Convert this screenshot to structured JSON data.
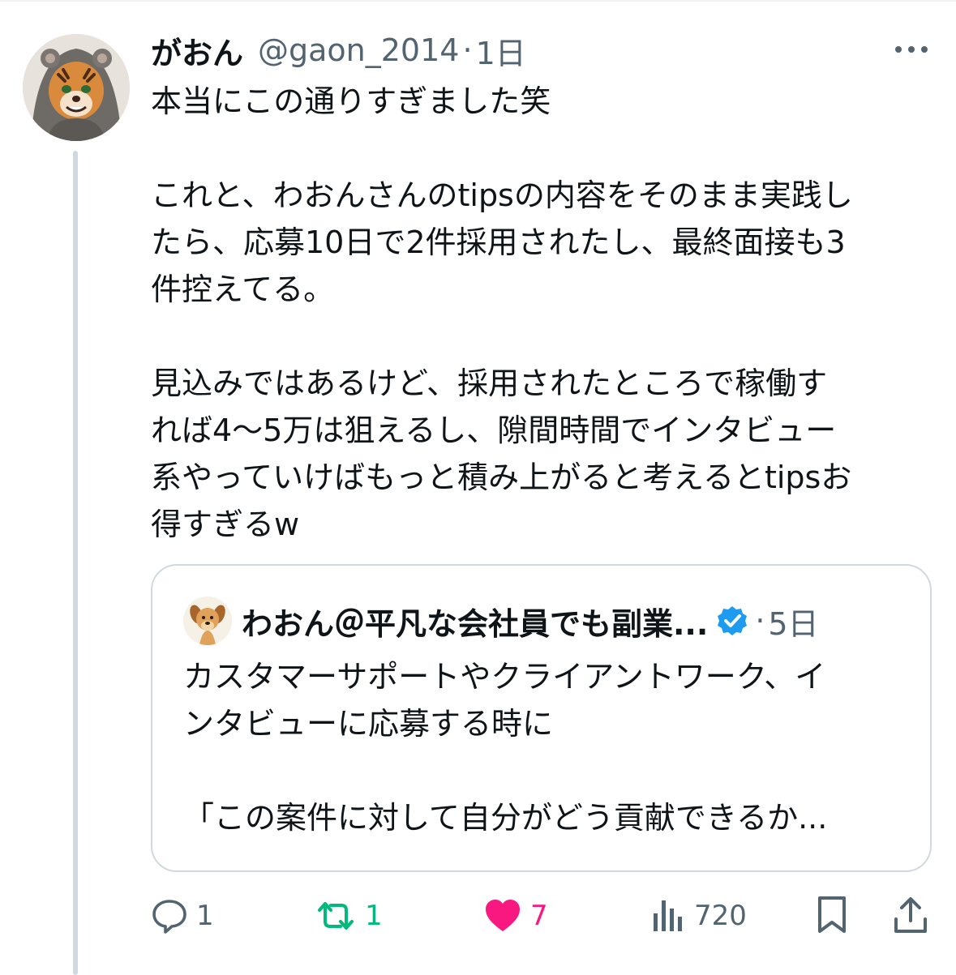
{
  "tweet": {
    "author": {
      "display_name": "がおん",
      "handle": "@gaon_2014",
      "separator": "·",
      "time": "1日",
      "avatar_icon": "tiger-hoodie-avatar"
    },
    "text_lines": [
      "本当にこの通りすぎました笑",
      "",
      "これと、わおんさんのtipsの内容をそのまま実践し",
      "たら、応募10日で2件採用されたし、最終面接も3",
      "件控えてる。",
      "",
      "見込みではあるけど、採用されたところで稼働す",
      "れば4〜5万は狙えるし、隙間時間でインタビュー",
      "系やっていけばもっと積み上がると考えるとtipsお",
      "得すぎるw"
    ]
  },
  "quoted_tweet": {
    "display_name": "わおん＠平凡な会社員でも副業...",
    "verified_icon": "verified-badge-icon",
    "separator": "·",
    "time": "5日",
    "avatar_icon": "dog-avatar",
    "text_lines": [
      "カスタマーサポートやクライアントワーク、イ",
      "ンタビューに応募する時に",
      "",
      "「この案件に対して自分がどう貢献できるか..."
    ]
  },
  "actions": {
    "replies": "1",
    "retweets": "1",
    "likes": "7",
    "views": "720"
  },
  "colors": {
    "text_primary": "#0f1419",
    "text_secondary": "#536471",
    "retweet_green": "#00ba7c",
    "like_pink": "#f91880",
    "verified_blue": "#1d9bf0",
    "border": "#cfd9de"
  }
}
